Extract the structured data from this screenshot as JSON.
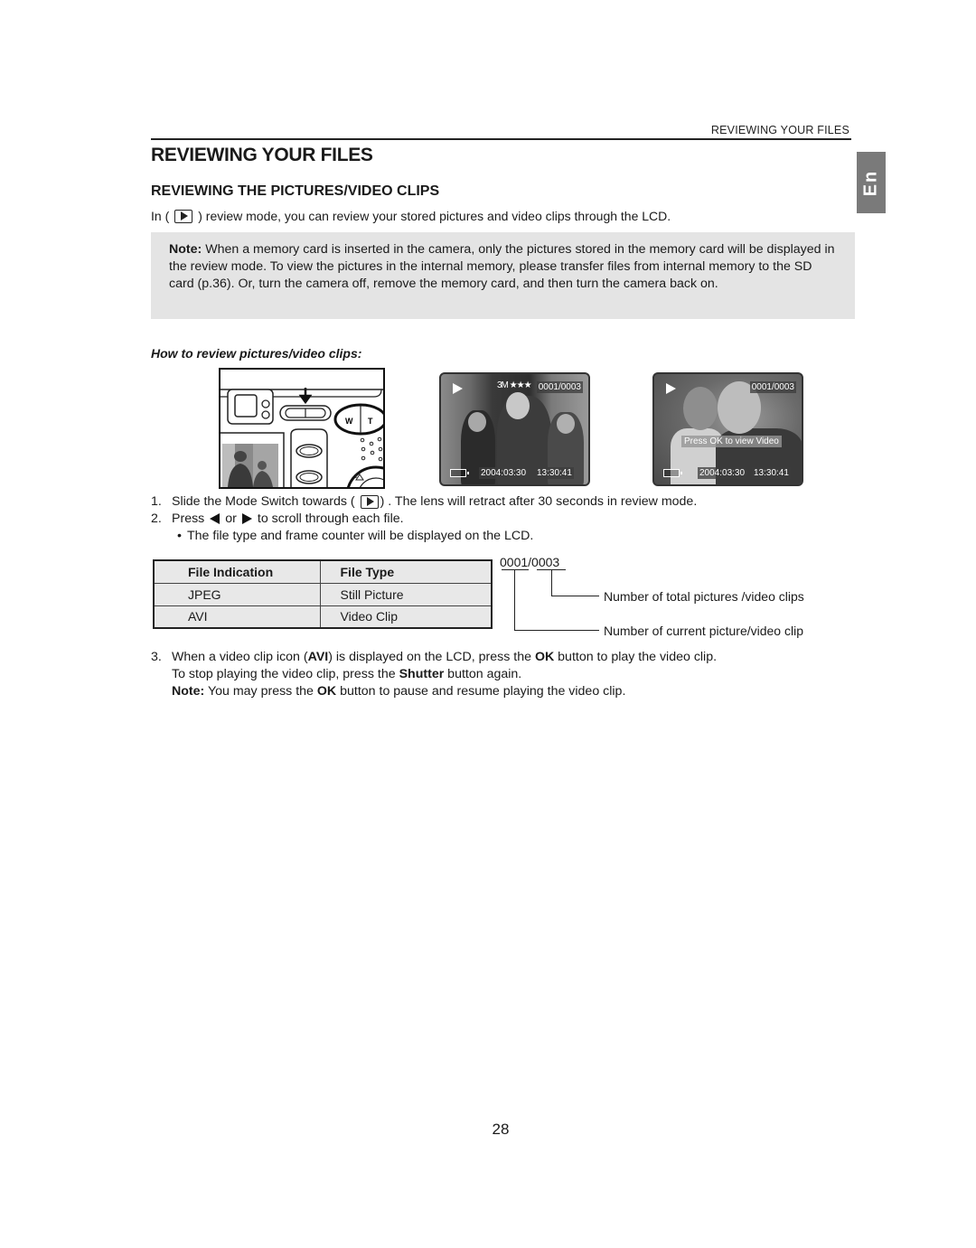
{
  "running_header": "REVIEWING YOUR FILES",
  "page_title": "REVIEWING YOUR FILES",
  "language_tab": "En",
  "section_title": "REVIEWING THE PICTURES/VIDEO CLIPS",
  "intro": {
    "before": "In (",
    "icon": "playback-mode-icon",
    "after": ") review mode, you can review your stored pictures and video clips through the LCD."
  },
  "note": {
    "label": "Note:",
    "text": " When a memory card is inserted in the camera, only the pictures stored in the memory card will be displayed in the review mode. To view the pictures in the internal memory, please transfer files from internal memory to the SD card (p.36). Or, turn the camera off, remove the memory card, and then turn the camera back on."
  },
  "howto_title": "How to review pictures/video clips:",
  "figures": {
    "camera": {
      "zoom_w": "W",
      "zoom_t": "T"
    },
    "lcd_photo": {
      "counter": "0001/0003",
      "quality": "3M ★★★",
      "date": "2004:03:30",
      "time": "13:30:41"
    },
    "lcd_video": {
      "counter": "0001/0003",
      "message": "Press OK to view Video",
      "date": "2004:03:30",
      "time": "13:30:41"
    }
  },
  "steps": {
    "s1": {
      "num": "1.",
      "before": "Slide the Mode Switch towards (",
      "after": ") . The lens will retract after 30 seconds in review mode."
    },
    "s2": {
      "num": "2.",
      "before": "Press",
      "mid": "or",
      "after": "to scroll through each file."
    },
    "bullet": {
      "mark": "•",
      "text": "The file type and frame counter will be displayed on the LCD."
    },
    "s3": {
      "num": "3.",
      "p1": "When a video clip icon (",
      "b1": "AVI",
      "p2": ") is displayed on the LCD, press the ",
      "b2": "OK",
      "p3": " button to play the video clip.",
      "l2a": "To stop playing the video clip, press the ",
      "l2b": "Shutter",
      "l2c": " button again.",
      "note_label": "Note:",
      "note_a": " You may press the ",
      "note_b": "OK",
      "note_c": " button to pause and resume playing the video clip."
    }
  },
  "file_table": {
    "headers": [
      "File Indication",
      "File Type"
    ],
    "rows": [
      [
        "JPEG",
        "Still Picture"
      ],
      [
        "AVI",
        "Video Clip"
      ]
    ]
  },
  "counter_diagram": {
    "current": "0001",
    "separator": "/",
    "total": "0003",
    "total_label": "Number of total pictures /video clips",
    "current_label": "Number of current picture/video clip"
  },
  "page_number": "28"
}
